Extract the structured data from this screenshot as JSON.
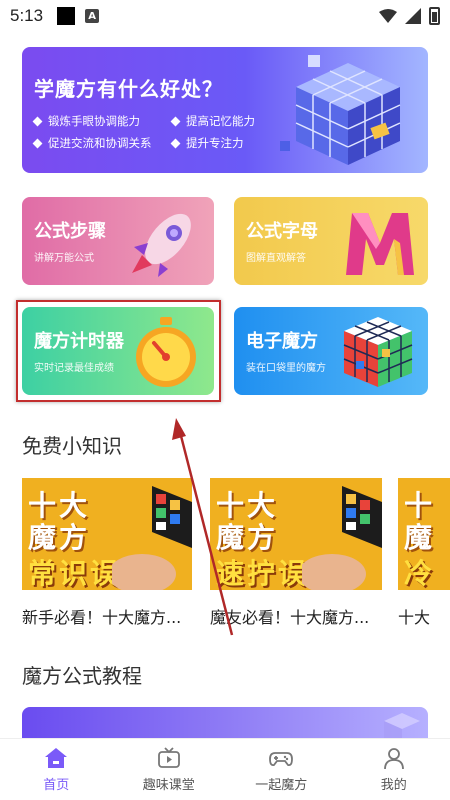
{
  "status": {
    "time": "5:13",
    "a_badge": "A"
  },
  "banner": {
    "title": "学魔方有什么好处？",
    "benefits": [
      "锻炼手眼协调能力",
      "提高记忆能力",
      "促进交流和协调关系",
      "提升专注力"
    ]
  },
  "cards": [
    {
      "title": "公式步骤",
      "subtitle": "讲解万能公式"
    },
    {
      "title": "公式字母",
      "subtitle": "图解直观解答"
    },
    {
      "title": "魔方计时器",
      "subtitle": "实时记录最佳成绩"
    },
    {
      "title": "电子魔方",
      "subtitle": "装在口袋里的魔方"
    }
  ],
  "section_free": {
    "title": "免费小知识"
  },
  "videos": [
    {
      "thumb_line1": "十大",
      "thumb_line2": "魔方",
      "thumb_line3": "常识误区",
      "caption": "新手必看！十大魔方..."
    },
    {
      "thumb_line1": "十大",
      "thumb_line2": "魔方",
      "thumb_line3": "速拧误区",
      "caption": "魔友必看！十大魔方..."
    },
    {
      "thumb_line1": "十",
      "thumb_line2": "魔",
      "thumb_line3": "冷",
      "caption": "十大"
    }
  ],
  "section_tutorial": {
    "title": "魔方公式教程"
  },
  "tabbar": {
    "tabs": [
      {
        "label": "首页",
        "icon": "home-icon"
      },
      {
        "label": "趣味课堂",
        "icon": "tv-icon"
      },
      {
        "label": "一起魔方",
        "icon": "gamepad-icon"
      },
      {
        "label": "我的",
        "icon": "user-icon"
      }
    ]
  },
  "colors": {
    "accent": "#7a5af8",
    "highlight_box": "#c22e2e"
  }
}
